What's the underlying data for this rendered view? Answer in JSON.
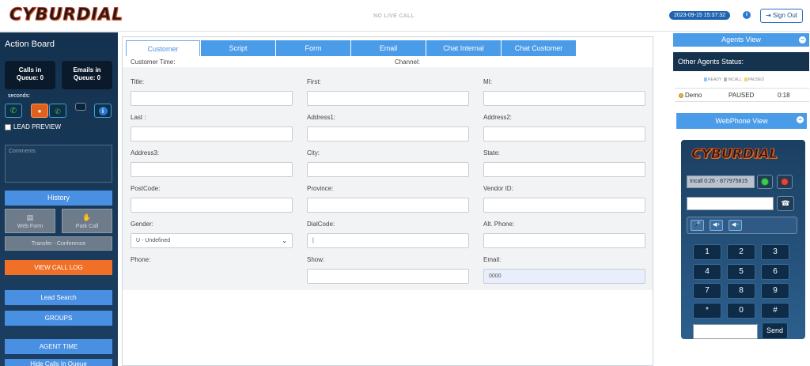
{
  "header": {
    "logo_text": "CYBURDIAL",
    "call_status": "NO LIVE CALL",
    "datetime": "2023-09-15 15:37:32",
    "signout_label": "Sign Out",
    "info_icon": "info-icon"
  },
  "sidebar": {
    "title": "Action Board",
    "calls_queue_label": "Calls in",
    "calls_queue_value": "Queue: 0",
    "emails_queue_label": "Emails in",
    "emails_queue_value": "Queue: 0",
    "seconds_label": "seconds:",
    "lead_preview_label": "LEAD PREVIEW",
    "comments_placeholder": "Comments",
    "history_label": "History",
    "web_form_label": "Web Form",
    "park_call_label": "Park Call",
    "transfer_label": "Transfer - Conference",
    "view_call_log_label": "VIEW CALL LOG",
    "lead_search_label": "Lead Search",
    "groups_label": "GROUPS",
    "agent_time_label": "AGENT TIME",
    "hide_calls_label": "Hide Calls In Queue"
  },
  "main": {
    "tabs": [
      {
        "label": "Customer"
      },
      {
        "label": "Script"
      },
      {
        "label": "Form"
      },
      {
        "label": "Email"
      },
      {
        "label": "Chat Internal"
      },
      {
        "label": "Chat Customer"
      }
    ],
    "customer_time_label": "Customer Time:",
    "channel_label": "Channel:",
    "fields": {
      "title": "Title:",
      "first": "First:",
      "mi": "MI:",
      "last": "Last :",
      "address1": "Address1:",
      "address2": "Address2:",
      "address3": "Address3:",
      "city": "City:",
      "state": "State:",
      "postcode": "PostCode:",
      "province": "Province:",
      "vendor_id": "Vendor ID:",
      "gender": "Gender:",
      "dialcode": "DialCode:",
      "alt_phone": "Alt. Phone:",
      "phone": "Phone:",
      "show": "Show:",
      "email": "Email:"
    },
    "gender_value": "U - Undefined",
    "dialcode_value": "|",
    "email_value": "0000"
  },
  "agents": {
    "header": "Agents View",
    "other_status_title": "Other Agents Status:",
    "legend": [
      "READY",
      "INCALL",
      "PAUSED"
    ],
    "legend_colors": [
      "#8fc4ff",
      "#b7b7b7",
      "#f3d36b"
    ],
    "rows": [
      {
        "name": "Demo",
        "status": "PAUSED",
        "time": "0:18"
      }
    ]
  },
  "webphone": {
    "header": "WebPhone View",
    "logo_text": "CYBURDIAL",
    "incall_text": "Incall 0:26 - 877975815",
    "keypad": [
      "1",
      "2",
      "3",
      "4",
      "5",
      "6",
      "7",
      "8",
      "9",
      "*",
      "0",
      "#"
    ],
    "send_label": "Send"
  }
}
